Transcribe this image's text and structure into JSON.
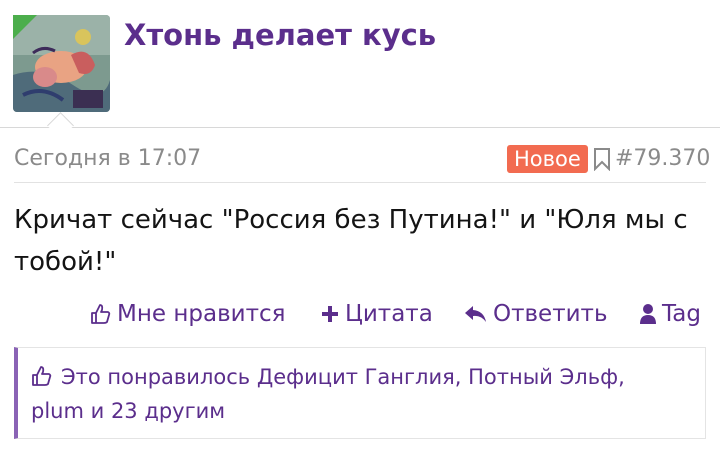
{
  "post": {
    "author": "Хтонь делает кусь",
    "timestamp": "Сегодня в 17:07",
    "badge": "Новое",
    "number": "#79.370",
    "message": "Кричат сейчас \"Россия без Путина!\" и \"Юля мы с тобой!\""
  },
  "actions": {
    "like": "Мне нравится",
    "quote": "Цитата",
    "reply": "Ответить",
    "tag": "Tag"
  },
  "likes": {
    "prefix": "Это понравилось",
    "user1": "Дефицит Ганглия",
    "sep1": ", ",
    "user2": "Потный Эльф",
    "sep2": ",",
    "user3": "plum",
    "middle": " и ",
    "others": "23 другим"
  },
  "colors": {
    "accent": "#5b2e8c",
    "badge": "#f26b50",
    "muted": "#8a8a8a",
    "likes_border": "#8a63b5"
  },
  "icons": [
    "thumbs-up-icon",
    "plus-icon",
    "reply-icon",
    "user-icon",
    "bookmark-icon"
  ]
}
